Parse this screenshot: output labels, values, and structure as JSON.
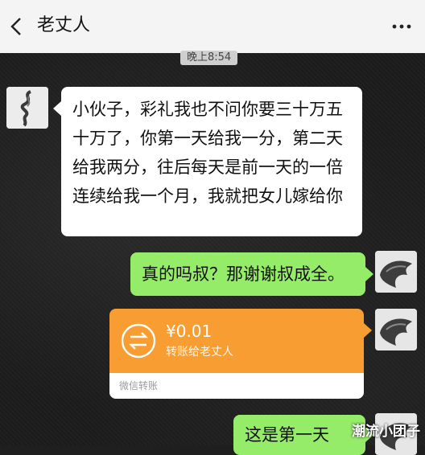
{
  "header": {
    "title": "老丈人",
    "back_icon": "chevron-left-icon",
    "more_icon": "more-dots-icon"
  },
  "chat": {
    "timestamp": "晚上8:54",
    "messages": [
      {
        "side": "left",
        "type": "text",
        "text": "小伙子，彩礼我也不问你要三十万五十万了，你第一天给我一分，第二天给我两分，往后每天是前一天的一倍 连续给我一个月，我就把女儿嫁给你"
      },
      {
        "side": "right",
        "type": "text",
        "text": "真的吗叔？那谢谢叔成全。"
      },
      {
        "side": "right",
        "type": "transfer",
        "amount": "¥0.01",
        "note": "转账给老丈人",
        "footer": "微信转账"
      },
      {
        "side": "right",
        "type": "text",
        "text": "这是第一天"
      }
    ]
  },
  "watermark": "潮流小团子",
  "colors": {
    "green_bubble": "#95ec69",
    "white_bubble": "#ffffff",
    "transfer_orange": "#f79d32",
    "header_bg": "#f4f4f4"
  }
}
